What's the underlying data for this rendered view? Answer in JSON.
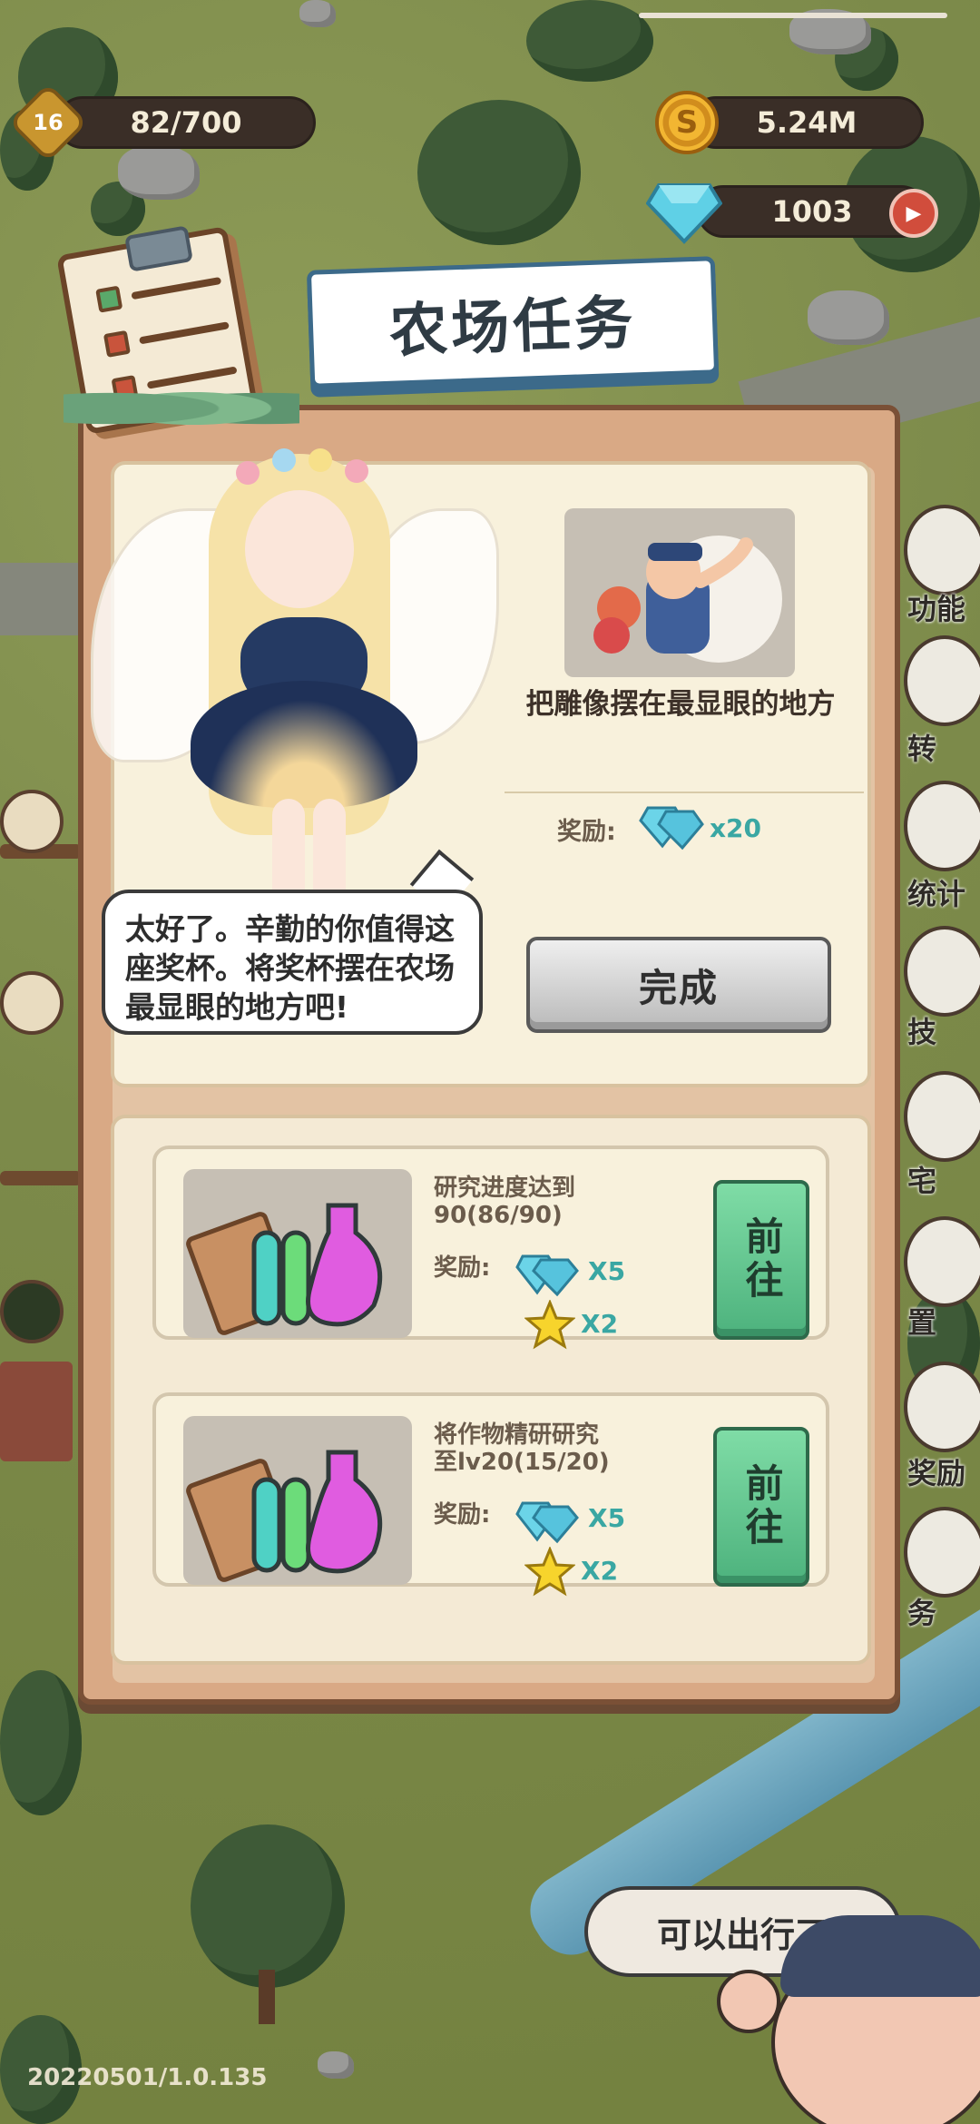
{
  "hud": {
    "level": "16",
    "xp": "82/700",
    "gold": "5.24M",
    "gems": "1003",
    "coin_glyph": "S",
    "video_glyph": "▶"
  },
  "panel": {
    "title": "农场任务",
    "main_task": {
      "speech": "太好了。辛勤的你值得这座奖杯。将奖杯摆在农场最显眼的地方吧!",
      "description": "把雕像摆在最显眼的地方",
      "reward_label": "奖励:",
      "reward_amount": "x20",
      "complete_button": "完成"
    },
    "sub_tasks": [
      {
        "title": "研究进度达到90(86/90)",
        "reward_label": "奖励:",
        "gem_reward": "X5",
        "star_reward": "X2",
        "go_button": "前往"
      },
      {
        "title": "将作物精研研究至lv20(15/20)",
        "reward_label": "奖励:",
        "gem_reward": "X5",
        "star_reward": "X2",
        "go_button": "前往"
      }
    ]
  },
  "side_menu": [
    "功能",
    "转",
    "统计",
    "技",
    "宅",
    "置",
    "奖励",
    "务"
  ],
  "npc_bubble": "可以出行了",
  "version": "20220501/1.0.135",
  "colors": {
    "panel_bg": "#d9a985",
    "card_bg": "#f8f1dc",
    "go_button": "#4db27d",
    "reward_text": "#3aa7a3"
  }
}
